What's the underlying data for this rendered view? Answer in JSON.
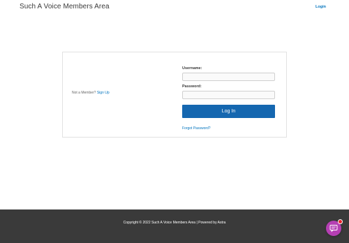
{
  "header": {
    "site_title": "Such A Voice Members Area",
    "nav_login": "Login"
  },
  "login_card": {
    "not_member_text": "Not a Member?",
    "signup_link": "Sign Up",
    "username_label": "Username:",
    "username_value": "",
    "password_label": "Password:",
    "password_value": "",
    "login_button": "Log In",
    "forgot_link": "Forgot Password?"
  },
  "footer": {
    "copyright": "Copyright © 2022 Such A Voice Members Area | Powered by Astra"
  },
  "chat_widget": {
    "icon": "chat-bubble-icon",
    "badge": "notification-dot"
  },
  "colors": {
    "accent": "#0274be",
    "button": "#1567b0",
    "footer_bg": "#3a3a3a",
    "chat_widget": "#b53fb3",
    "badge": "#e8202a"
  }
}
